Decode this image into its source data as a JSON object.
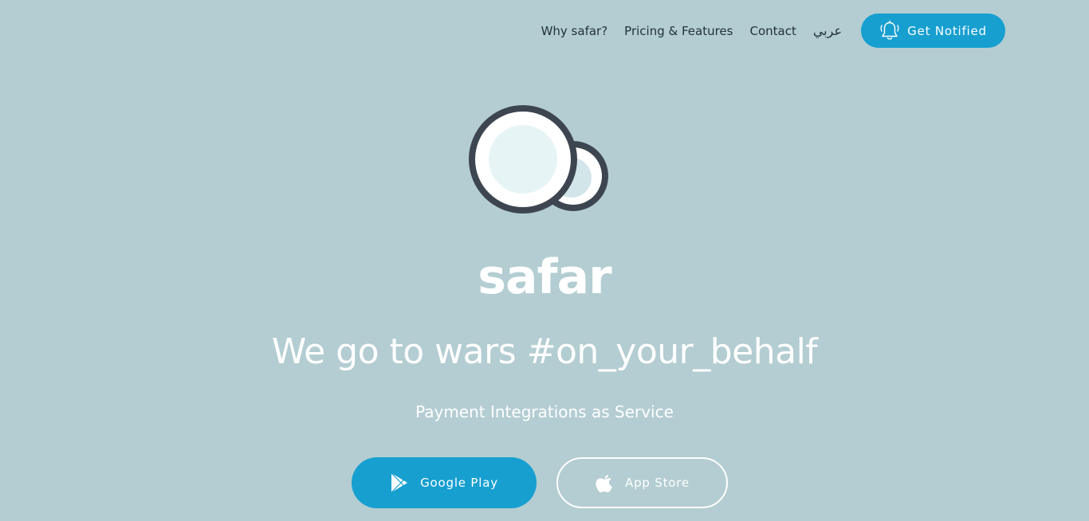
{
  "nav": {
    "items": [
      {
        "label": "Why safar?"
      },
      {
        "label": "Pricing & Features"
      },
      {
        "label": "Contact"
      },
      {
        "label": "عربي"
      }
    ],
    "notify_button": {
      "label": "Get Notified",
      "icon": "bell-icon"
    }
  },
  "hero": {
    "brand": "safar",
    "headline": "We go to wars #on_your_behalf",
    "subheadline": "Payment Integrations as Service"
  },
  "stores": {
    "google_play": {
      "label": "Google Play",
      "icon": "google-play-icon"
    },
    "app_store": {
      "label": "App Store",
      "icon": "apple-icon"
    }
  },
  "colors": {
    "background": "#b3cdd2",
    "accent": "#179fd0",
    "nav_text": "#23333a",
    "logo_ring": "#3d4650",
    "logo_inner": "#e6f4f6"
  }
}
